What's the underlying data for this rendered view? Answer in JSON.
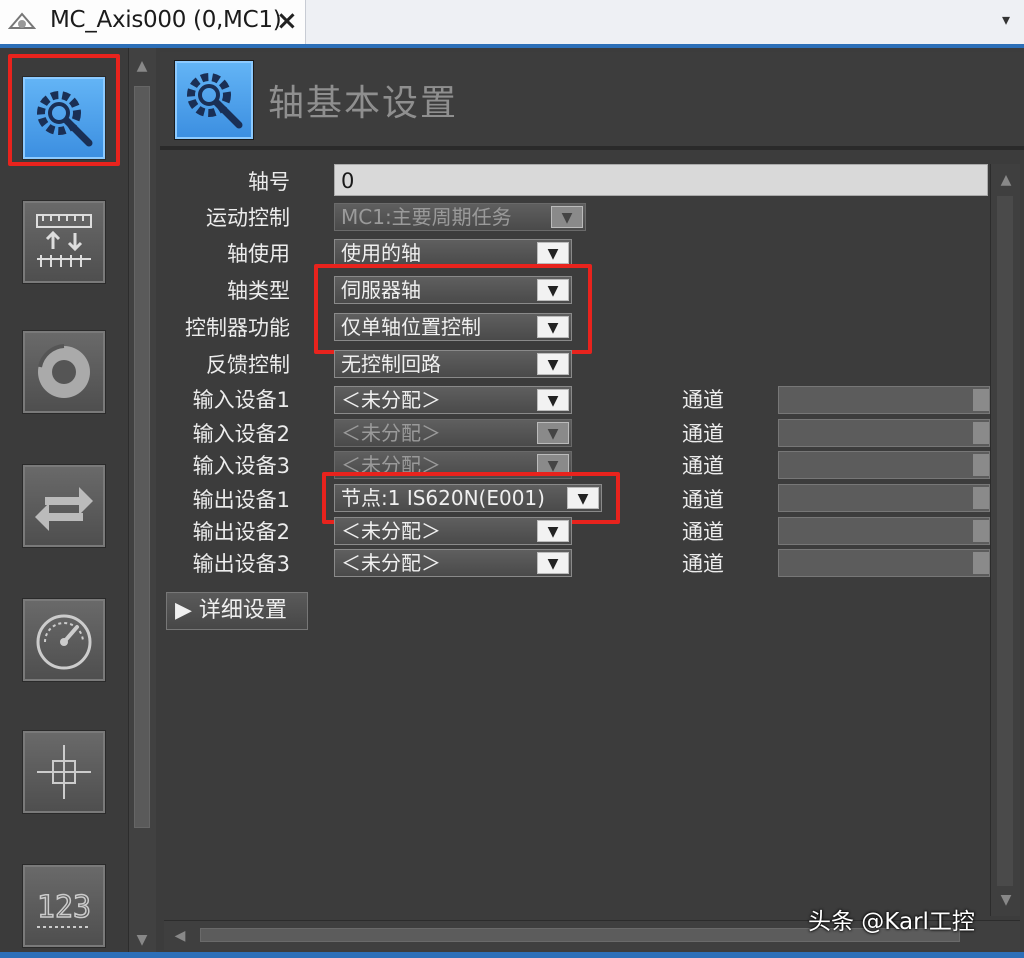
{
  "tab": {
    "title": "MC_Axis000 (0,MC1)",
    "close": "×",
    "dropdown": "▾"
  },
  "header": {
    "title": "轴基本设置"
  },
  "sidebar": {
    "items": [
      {
        "name": "axis-basic-settings",
        "icon": "gear-wrench-icon",
        "active": true
      },
      {
        "name": "unit-conversion",
        "icon": "ruler-icon",
        "active": false
      },
      {
        "name": "operation-settings",
        "icon": "dial-icon",
        "active": false
      },
      {
        "name": "other-operation",
        "icon": "exchange-arrows-icon",
        "active": false
      },
      {
        "name": "limit-settings",
        "icon": "gauge-icon",
        "active": false
      },
      {
        "name": "position-count",
        "icon": "crosshair-icon",
        "active": false
      },
      {
        "name": "servo-drive",
        "icon": "numeric-123-icon",
        "active": false
      }
    ],
    "numeric_label": "123"
  },
  "form": {
    "axis_number": {
      "label": "轴号",
      "value": "0"
    },
    "motion_control": {
      "label": "运动控制",
      "value": "MC1:主要周期任务"
    },
    "axis_use": {
      "label": "轴使用",
      "value": "使用的轴"
    },
    "axis_type": {
      "label": "轴类型",
      "value": "伺服器轴"
    },
    "controller_function": {
      "label": "控制器功能",
      "value": "仅单轴位置控制"
    },
    "feedback_control": {
      "label": "反馈控制",
      "value": "无控制回路"
    },
    "input_device_1": {
      "label": "输入设备1",
      "value": "＜未分配＞"
    },
    "input_device_2": {
      "label": "输入设备2",
      "value": "＜未分配＞"
    },
    "input_device_3": {
      "label": "输入设备3",
      "value": "＜未分配＞"
    },
    "output_device_1": {
      "label": "输出设备1",
      "value": "节点:1 IS620N(E001)"
    },
    "output_device_2": {
      "label": "输出设备2",
      "value": "＜未分配＞"
    },
    "output_device_3": {
      "label": "输出设备3",
      "value": "＜未分配＞"
    },
    "channel_label": "通道",
    "detail_settings": "▶ 详细设置"
  },
  "dropdown_glyph": "▼",
  "watermark": "头条 @Karl工控",
  "colors": {
    "accent_blue": "#3b8ee0",
    "highlight_red": "#e8231d",
    "panel_bg": "#3c3c3c"
  }
}
